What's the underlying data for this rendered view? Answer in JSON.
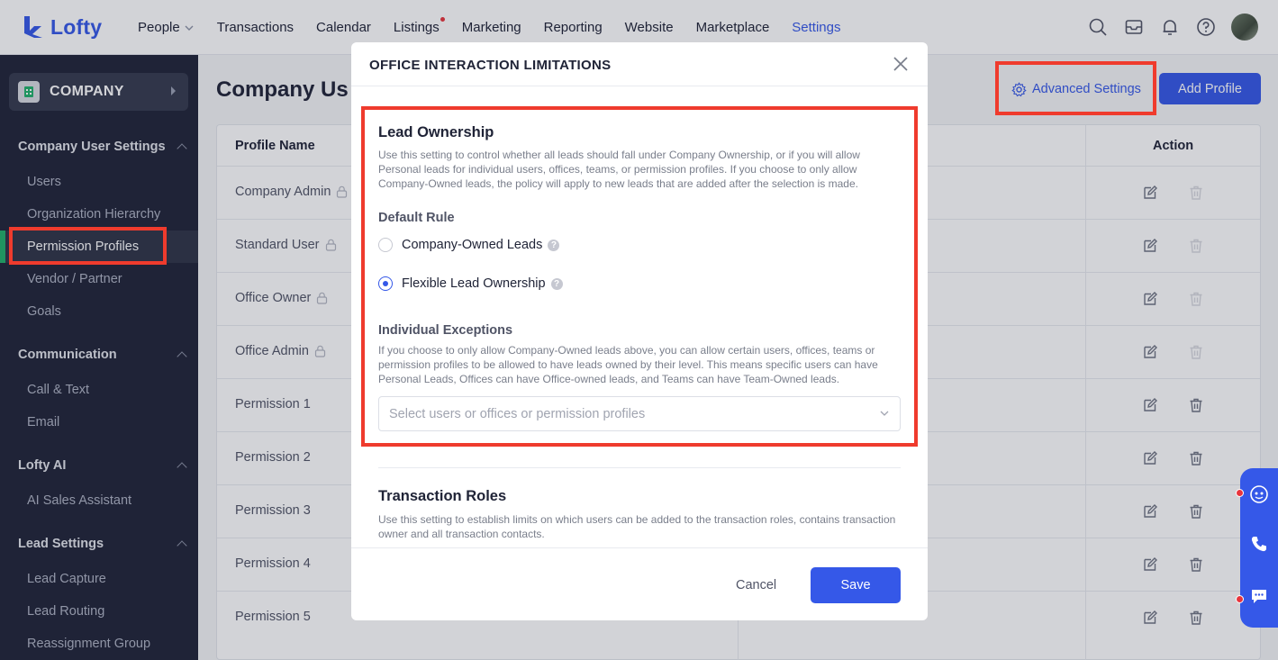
{
  "app": {
    "logo_text": "Lofty",
    "nav": [
      {
        "label": "People",
        "has_dropdown": true
      },
      {
        "label": "Transactions"
      },
      {
        "label": "Calendar"
      },
      {
        "label": "Listings",
        "has_dot": true
      },
      {
        "label": "Marketing"
      },
      {
        "label": "Reporting"
      },
      {
        "label": "Website"
      },
      {
        "label": "Marketplace"
      },
      {
        "label": "Settings",
        "active": true
      }
    ],
    "accent_color": "#3558e8"
  },
  "sidebar": {
    "company_label": "COMPANY",
    "sections": [
      {
        "title": "Company User Settings",
        "items": [
          "Users",
          "Organization Hierarchy",
          "Permission Profiles",
          "Vendor / Partner",
          "Goals"
        ]
      },
      {
        "title": "Communication",
        "items": [
          "Call & Text",
          "Email"
        ]
      },
      {
        "title": "Lofty AI",
        "items": [
          "AI Sales Assistant"
        ]
      },
      {
        "title": "Lead Settings",
        "items": [
          "Lead Capture",
          "Lead Routing",
          "Reassignment Group"
        ]
      }
    ],
    "active_item": "Permission Profiles"
  },
  "main": {
    "title": "Company Us",
    "advanced_settings_label": "Advanced Settings",
    "add_profile_label": "Add Profile",
    "table": {
      "col_profile": "Profile Name",
      "col_action": "Action",
      "rows": [
        {
          "name": "Company Admin",
          "locked": true
        },
        {
          "name": "Standard User",
          "locked": true
        },
        {
          "name": "Office Owner",
          "locked": true
        },
        {
          "name": "Office Admin",
          "locked": true
        },
        {
          "name": "Permission 1",
          "locked": false
        },
        {
          "name": "Permission 2",
          "locked": false
        },
        {
          "name": "Permission 3",
          "locked": false
        },
        {
          "name": "Permission 4",
          "locked": false
        },
        {
          "name": "Permission 5",
          "locked": false
        }
      ]
    }
  },
  "modal": {
    "title": "OFFICE INTERACTION LIMITATIONS",
    "lead_ownership": {
      "title": "Lead Ownership",
      "description": "Use this setting to control whether all leads should fall under Company Ownership, or if you will allow Personal leads for individual users, offices, teams, or permission profiles. If you choose to only allow Company-Owned leads, the policy will apply to new leads that are added after the selection is made.",
      "default_rule_label": "Default Rule",
      "option_company": "Company-Owned Leads",
      "option_flexible": "Flexible Lead Ownership",
      "selected": "Flexible Lead Ownership",
      "exceptions_label": "Individual Exceptions",
      "exceptions_description": "If you choose to only allow Company-Owned leads above, you can allow certain users, offices, teams or permission profiles to be allowed to have leads owned by their level. This means specific users can have Personal Leads, Offices can have Office-owned leads, and Teams can have Team-Owned leads.",
      "select_placeholder": "Select users or offices or permission profiles"
    },
    "transaction_roles": {
      "title": "Transaction Roles",
      "description": "Use this setting to establish limits on which users can be added to the transaction roles, contains transaction owner and all transaction contacts."
    },
    "cancel_label": "Cancel",
    "save_label": "Save"
  },
  "highlight_color": "#ef3b2d"
}
